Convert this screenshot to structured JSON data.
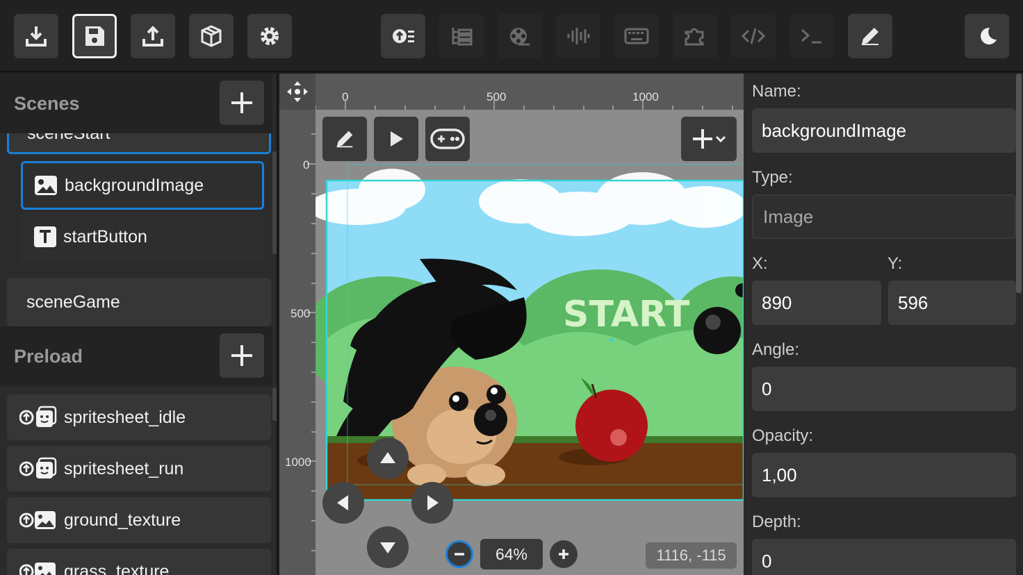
{
  "toolbar": {
    "left_icons": [
      "download-icon",
      "save-icon",
      "upload-icon",
      "package-icon",
      "gear-icon"
    ],
    "center_icons": [
      "asset-loader-icon",
      "list-icon",
      "film-reel-icon",
      "audio-wave-icon",
      "keyboard-icon",
      "puzzle-icon",
      "code-icon",
      "terminal-icon",
      "pencil-icon"
    ],
    "right_icons": [
      "moon-icon"
    ]
  },
  "scenes": {
    "title": "Scenes",
    "partial_item": "sceneStart",
    "children": [
      {
        "label": "backgroundImage",
        "icon": "image-icon",
        "selected": true
      },
      {
        "label": "startButton",
        "icon": "text-icon",
        "selected": false
      }
    ],
    "items": [
      "sceneGame"
    ]
  },
  "preload": {
    "title": "Preload",
    "items": [
      {
        "label": "spritesheet_idle",
        "icon": "spritesheet-icon"
      },
      {
        "label": "spritesheet_run",
        "icon": "spritesheet-icon"
      },
      {
        "label": "ground_texture",
        "icon": "image-asset-icon"
      },
      {
        "label": "grass_texture",
        "icon": "image-asset-icon"
      }
    ]
  },
  "stage": {
    "ruler_x": [
      "0",
      "500",
      "1000"
    ],
    "ruler_y": [
      "0",
      "500",
      "1000"
    ],
    "game_text": "START",
    "zoom": "64%",
    "cursor_coords": "1116, -115",
    "colors": {
      "sky": "#8fdcf7",
      "hills": "#6fcf7b",
      "ground": "#6b3a12",
      "selection": "#33d6d6"
    }
  },
  "properties": {
    "name_label": "Name:",
    "name_value": "backgroundImage",
    "type_label": "Type:",
    "type_value": "Image",
    "x_label": "X:",
    "x_value": "890",
    "y_label": "Y:",
    "y_value": "596",
    "angle_label": "Angle:",
    "angle_value": "0",
    "opacity_label": "Opacity:",
    "opacity_value": "1,00",
    "depth_label": "Depth:",
    "depth_value": "0"
  }
}
